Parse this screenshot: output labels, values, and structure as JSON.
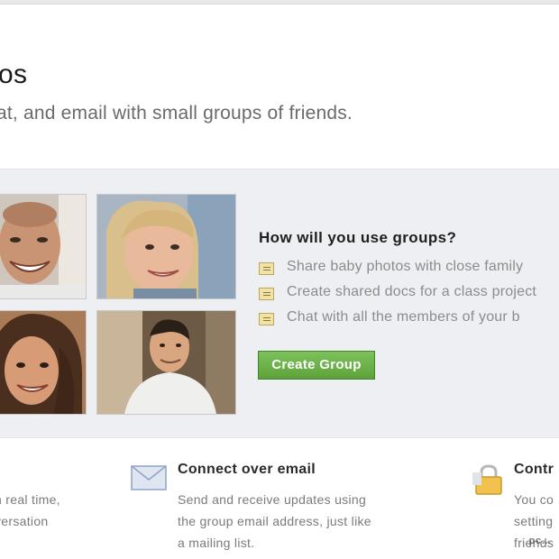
{
  "header": {
    "title": "os",
    "subtitle": "at, and email with small groups of friends."
  },
  "promo": {
    "heading": "How will you use groups?",
    "uses": [
      {
        "text": "Share baby photos with close family",
        "icon": "document-icon"
      },
      {
        "text": "Create shared docs for a class project",
        "icon": "document-icon"
      },
      {
        "text": "Chat with all the members of your b",
        "icon": "document-icon"
      }
    ],
    "create_button": "Create Group"
  },
  "features": {
    "left": {
      "desc_lines": [
        "n real time,",
        "versation"
      ]
    },
    "email": {
      "title": "Connect over email",
      "desc_lines": [
        "Send and receive updates using",
        "the group email address, just like",
        "a mailing list."
      ],
      "icon": "envelope-icon"
    },
    "control": {
      "title": "Contr",
      "desc_lines": [
        "You co",
        "setting",
        "friends"
      ],
      "icon": "lock-icon"
    }
  },
  "watermark": "pc…",
  "colors": {
    "button_green": "#5ea23c",
    "panel_bg": "#eeeff3",
    "muted_text": "#8c8c8c"
  }
}
